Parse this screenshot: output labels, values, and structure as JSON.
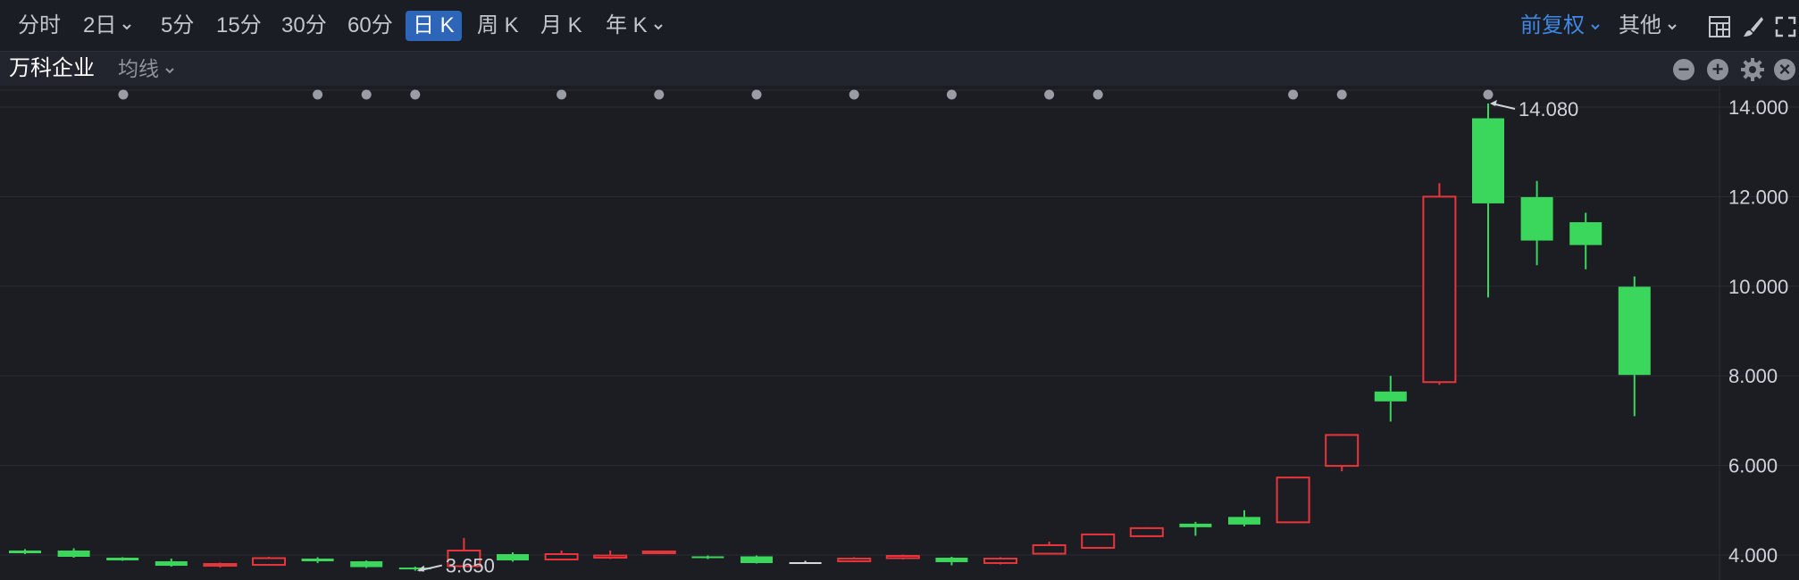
{
  "toolbar": {
    "timeframes": [
      "分时",
      "2日",
      "5分",
      "15分",
      "30分",
      "60分",
      "日 K",
      "周 K",
      "月 K",
      "年 K"
    ],
    "active": "日 K",
    "adjust_label": "前复权",
    "other_label": "其他"
  },
  "subbar": {
    "stock_name": "万科企业",
    "ma_label": "均线"
  },
  "chart_data": {
    "type": "candlestick",
    "ylim": [
      3.6,
      14.5
    ],
    "y_ticks": [
      "14.000",
      "12.000",
      "10.000",
      "8.000",
      "6.000",
      "4.000"
    ],
    "up_color": "#e8353a",
    "down_color": "#3bd65c",
    "max_label": "14.080",
    "min_label": "3.650",
    "candles": [
      {
        "o": 4.1,
        "c": 4.04,
        "h": 4.13,
        "l": 4.02
      },
      {
        "o": 4.1,
        "c": 3.96,
        "h": 4.15,
        "l": 3.94
      },
      {
        "o": 3.94,
        "c": 3.88,
        "h": 3.95,
        "l": 3.87
      },
      {
        "o": 3.86,
        "c": 3.76,
        "h": 3.92,
        "l": 3.74
      },
      {
        "o": 3.78,
        "c": 3.8,
        "h": 3.83,
        "l": 3.72
      },
      {
        "o": 3.78,
        "c": 3.93,
        "h": 3.96,
        "l": 3.77
      },
      {
        "o": 3.92,
        "c": 3.86,
        "h": 3.95,
        "l": 3.82
      },
      {
        "o": 3.86,
        "c": 3.73,
        "h": 3.88,
        "l": 3.71
      },
      {
        "o": 3.72,
        "c": 3.68,
        "h": 3.74,
        "l": 3.65
      },
      {
        "o": 3.75,
        "c": 4.1,
        "h": 4.38,
        "l": 3.74
      },
      {
        "o": 4.02,
        "c": 3.88,
        "h": 4.06,
        "l": 3.85
      },
      {
        "o": 3.9,
        "c": 4.02,
        "h": 4.1,
        "l": 3.88
      },
      {
        "o": 3.94,
        "c": 3.99,
        "h": 4.1,
        "l": 3.91
      },
      {
        "o": 4.05,
        "c": 4.08,
        "h": 4.1,
        "l": 4.03
      },
      {
        "o": 3.97,
        "c": 3.95,
        "h": 3.99,
        "l": 3.91
      },
      {
        "o": 3.97,
        "c": 3.82,
        "h": 3.99,
        "l": 3.81
      },
      {
        "o": 3.84,
        "c": 3.84,
        "h": 3.87,
        "l": 3.81
      },
      {
        "o": 3.86,
        "c": 3.92,
        "h": 3.95,
        "l": 3.84
      },
      {
        "o": 3.93,
        "c": 3.98,
        "h": 4.01,
        "l": 3.9
      },
      {
        "o": 3.94,
        "c": 3.84,
        "h": 3.96,
        "l": 3.77
      },
      {
        "o": 3.82,
        "c": 3.92,
        "h": 3.95,
        "l": 3.79
      },
      {
        "o": 4.03,
        "c": 4.22,
        "h": 4.3,
        "l": 4.03
      },
      {
        "o": 4.16,
        "c": 4.46,
        "h": 4.48,
        "l": 4.15
      },
      {
        "o": 4.42,
        "c": 4.6,
        "h": 4.62,
        "l": 4.41
      },
      {
        "o": 4.7,
        "c": 4.62,
        "h": 4.74,
        "l": 4.43
      },
      {
        "o": 4.85,
        "c": 4.68,
        "h": 5.0,
        "l": 4.64
      },
      {
        "o": 4.73,
        "c": 5.73,
        "h": 5.75,
        "l": 4.72
      },
      {
        "o": 5.99,
        "c": 6.68,
        "h": 6.7,
        "l": 5.87
      },
      {
        "o": 7.65,
        "c": 7.43,
        "h": 8.0,
        "l": 6.98
      },
      {
        "o": 7.86,
        "c": 12.0,
        "h": 12.3,
        "l": 7.8
      },
      {
        "o": 13.75,
        "c": 11.85,
        "h": 14.08,
        "l": 9.75
      },
      {
        "o": 11.99,
        "c": 11.02,
        "h": 12.35,
        "l": 10.47
      },
      {
        "o": 11.43,
        "c": 10.92,
        "h": 11.64,
        "l": 10.38
      },
      {
        "o": 9.99,
        "c": 8.02,
        "h": 10.22,
        "l": 7.1
      }
    ]
  }
}
